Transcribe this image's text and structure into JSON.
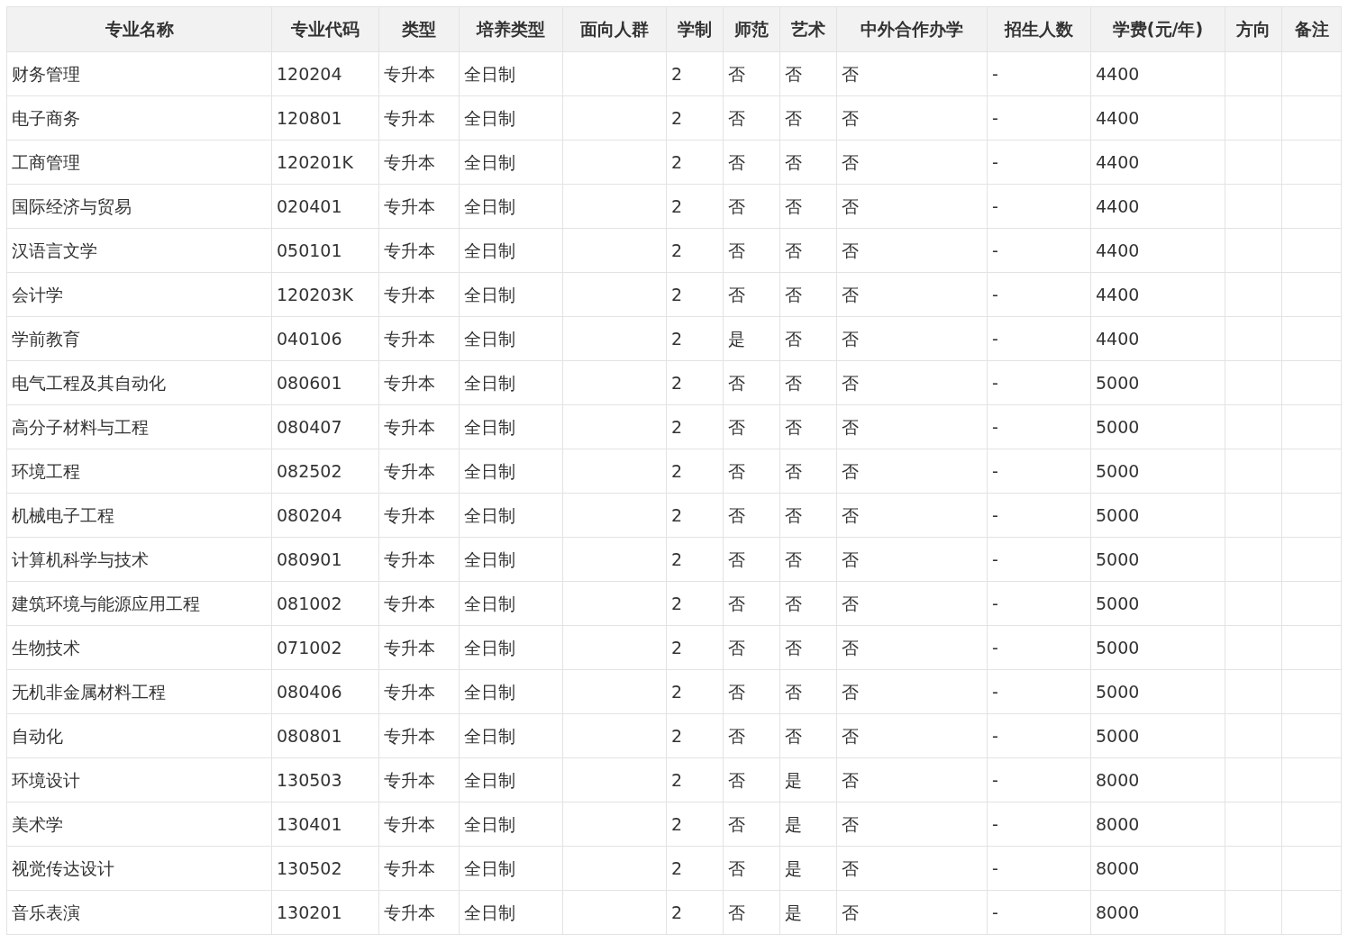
{
  "table": {
    "columns": [
      "专业名称",
      "专业代码",
      "类型",
      "培养类型",
      "面向人群",
      "学制",
      "师范",
      "艺术",
      "中外合作办学",
      "招生人数",
      "学费(元/年)",
      "方向",
      "备注"
    ],
    "rows": [
      {
        "name": "财务管理",
        "code": "120204",
        "type": "专升本",
        "mode": "全日制",
        "years": "2",
        "normal": "否",
        "art": "否",
        "coop": "否",
        "count": "-",
        "fee": "4400"
      },
      {
        "name": "电子商务",
        "code": "120801",
        "type": "专升本",
        "mode": "全日制",
        "years": "2",
        "normal": "否",
        "art": "否",
        "coop": "否",
        "count": "-",
        "fee": "4400"
      },
      {
        "name": "工商管理",
        "code": "120201K",
        "type": "专升本",
        "mode": "全日制",
        "years": "2",
        "normal": "否",
        "art": "否",
        "coop": "否",
        "count": "-",
        "fee": "4400"
      },
      {
        "name": "国际经济与贸易",
        "code": "020401",
        "type": "专升本",
        "mode": "全日制",
        "years": "2",
        "normal": "否",
        "art": "否",
        "coop": "否",
        "count": "-",
        "fee": "4400"
      },
      {
        "name": "汉语言文学",
        "code": "050101",
        "type": "专升本",
        "mode": "全日制",
        "years": "2",
        "normal": "否",
        "art": "否",
        "coop": "否",
        "count": "-",
        "fee": "4400"
      },
      {
        "name": "会计学",
        "code": "120203K",
        "type": "专升本",
        "mode": "全日制",
        "years": "2",
        "normal": "否",
        "art": "否",
        "coop": "否",
        "count": "-",
        "fee": "4400"
      },
      {
        "name": "学前教育",
        "code": "040106",
        "type": "专升本",
        "mode": "全日制",
        "years": "2",
        "normal": "是",
        "art": "否",
        "coop": "否",
        "count": "-",
        "fee": "4400"
      },
      {
        "name": "电气工程及其自动化",
        "code": "080601",
        "type": "专升本",
        "mode": "全日制",
        "years": "2",
        "normal": "否",
        "art": "否",
        "coop": "否",
        "count": "-",
        "fee": "5000"
      },
      {
        "name": "高分子材料与工程",
        "code": "080407",
        "type": "专升本",
        "mode": "全日制",
        "years": "2",
        "normal": "否",
        "art": "否",
        "coop": "否",
        "count": "-",
        "fee": "5000"
      },
      {
        "name": "环境工程",
        "code": "082502",
        "type": "专升本",
        "mode": "全日制",
        "years": "2",
        "normal": "否",
        "art": "否",
        "coop": "否",
        "count": "-",
        "fee": "5000"
      },
      {
        "name": "机械电子工程",
        "code": "080204",
        "type": "专升本",
        "mode": "全日制",
        "years": "2",
        "normal": "否",
        "art": "否",
        "coop": "否",
        "count": "-",
        "fee": "5000"
      },
      {
        "name": "计算机科学与技术",
        "code": "080901",
        "type": "专升本",
        "mode": "全日制",
        "years": "2",
        "normal": "否",
        "art": "否",
        "coop": "否",
        "count": "-",
        "fee": "5000"
      },
      {
        "name": "建筑环境与能源应用工程",
        "code": "081002",
        "type": "专升本",
        "mode": "全日制",
        "years": "2",
        "normal": "否",
        "art": "否",
        "coop": "否",
        "count": "-",
        "fee": "5000"
      },
      {
        "name": "生物技术",
        "code": "071002",
        "type": "专升本",
        "mode": "全日制",
        "years": "2",
        "normal": "否",
        "art": "否",
        "coop": "否",
        "count": "-",
        "fee": "5000"
      },
      {
        "name": "无机非金属材料工程",
        "code": "080406",
        "type": "专升本",
        "mode": "全日制",
        "years": "2",
        "normal": "否",
        "art": "否",
        "coop": "否",
        "count": "-",
        "fee": "5000"
      },
      {
        "name": "自动化",
        "code": "080801",
        "type": "专升本",
        "mode": "全日制",
        "years": "2",
        "normal": "否",
        "art": "否",
        "coop": "否",
        "count": "-",
        "fee": "5000"
      },
      {
        "name": "环境设计",
        "code": "130503",
        "type": "专升本",
        "mode": "全日制",
        "years": "2",
        "normal": "否",
        "art": "是",
        "coop": "否",
        "count": "-",
        "fee": "8000"
      },
      {
        "name": "美术学",
        "code": "130401",
        "type": "专升本",
        "mode": "全日制",
        "years": "2",
        "normal": "否",
        "art": "是",
        "coop": "否",
        "count": "-",
        "fee": "8000"
      },
      {
        "name": "视觉传达设计",
        "code": "130502",
        "type": "专升本",
        "mode": "全日制",
        "years": "2",
        "normal": "否",
        "art": "是",
        "coop": "否",
        "count": "-",
        "fee": "8000"
      },
      {
        "name": "音乐表演",
        "code": "130201",
        "type": "专升本",
        "mode": "全日制",
        "years": "2",
        "normal": "否",
        "art": "是",
        "coop": "否",
        "count": "-",
        "fee": "8000"
      }
    ]
  }
}
